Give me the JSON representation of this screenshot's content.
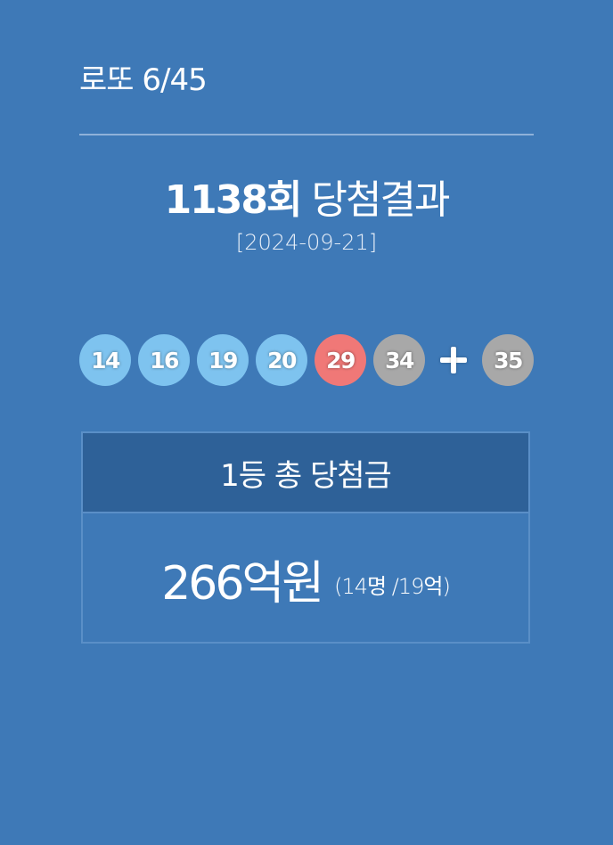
{
  "header": {
    "brand": "로또 6/45"
  },
  "draw": {
    "round_label": "1138회",
    "result_label": "당첨결과",
    "date": "[2024-09-21]"
  },
  "numbers": {
    "main": [
      {
        "value": "14",
        "color": "#7ec3ef"
      },
      {
        "value": "16",
        "color": "#7ec3ef"
      },
      {
        "value": "19",
        "color": "#7ec3ef"
      },
      {
        "value": "20",
        "color": "#7ec3ef"
      },
      {
        "value": "29",
        "color": "#f07877"
      },
      {
        "value": "34",
        "color": "#a8a8a8"
      }
    ],
    "bonus": {
      "value": "35",
      "color": "#a8a8a8"
    },
    "plus_icon": "plus-icon"
  },
  "prize": {
    "heading": "1등 총 당첨금",
    "amount": "266억원",
    "detail": "(14명 /19억)"
  }
}
